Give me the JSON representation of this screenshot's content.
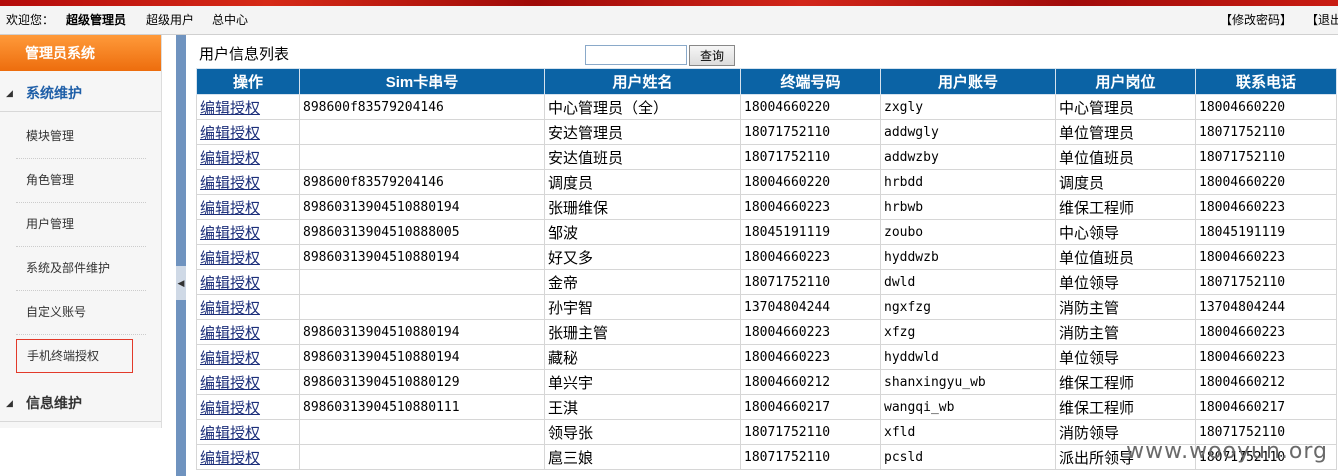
{
  "topbar": {
    "welcome": "欢迎您：",
    "user_name": "超级管理员",
    "role": "超级用户",
    "center": "总中心",
    "change_password": "【修改密码】",
    "logout": "【退出"
  },
  "sidebar": {
    "header": "管理员系统",
    "groups": [
      {
        "label": "系统维护"
      },
      {
        "label": "信息维护"
      }
    ],
    "items": [
      {
        "label": "模块管理"
      },
      {
        "label": "角色管理"
      },
      {
        "label": "用户管理"
      },
      {
        "label": "系统及部件维护"
      },
      {
        "label": "自定义账号"
      },
      {
        "label": "手机终端授权"
      }
    ],
    "active_item": "手机终端授权"
  },
  "main": {
    "title": "用户信息列表",
    "search": {
      "value": "",
      "placeholder": ""
    },
    "query_button": "查询",
    "columns": [
      "操作",
      "Sim卡串号",
      "用户姓名",
      "终端号码",
      "用户账号",
      "用户岗位",
      "联系电话"
    ],
    "rows": [
      [
        "编辑授权",
        "898600f83579204146",
        "中心管理员（全）",
        "18004660220",
        "zxgly",
        "中心管理员",
        "18004660220"
      ],
      [
        "编辑授权",
        "",
        "安达管理员",
        "18071752110",
        "addwgly",
        "单位管理员",
        "18071752110"
      ],
      [
        "编辑授权",
        "",
        "安达值班员",
        "18071752110",
        "addwzby",
        "单位值班员",
        "18071752110"
      ],
      [
        "编辑授权",
        "898600f83579204146",
        "调度员",
        "18004660220",
        "hrbdd",
        "调度员",
        "18004660220"
      ],
      [
        "编辑授权",
        "89860313904510880194",
        "张珊维保",
        "18004660223",
        "hrbwb",
        "维保工程师",
        "18004660223"
      ],
      [
        "编辑授权",
        "89860313904510888005",
        "邹波",
        "18045191119",
        "zoubo",
        "中心领导",
        "18045191119"
      ],
      [
        "编辑授权",
        "89860313904510880194",
        "好又多",
        "18004660223",
        "hyddwzb",
        "单位值班员",
        "18004660223"
      ],
      [
        "编辑授权",
        "",
        "金帝",
        "18071752110",
        "dwld",
        "单位领导",
        "18071752110"
      ],
      [
        "编辑授权",
        "",
        "孙宇智",
        "13704804244",
        "ngxfzg",
        "消防主管",
        "13704804244"
      ],
      [
        "编辑授权",
        "89860313904510880194",
        "张珊主管",
        "18004660223",
        "xfzg",
        "消防主管",
        "18004660223"
      ],
      [
        "编辑授权",
        "89860313904510880194",
        "藏秘",
        "18004660223",
        "hyddwld",
        "单位领导",
        "18004660223"
      ],
      [
        "编辑授权",
        "89860313904510880129",
        "单兴宇",
        "18004660212",
        "shanxingyu_wb",
        "维保工程师",
        "18004660212"
      ],
      [
        "编辑授权",
        "89860313904510880111",
        "王淇",
        "18004660217",
        "wangqi_wb",
        "维保工程师",
        "18004660217"
      ],
      [
        "编辑授权",
        "",
        "领导张",
        "18071752110",
        "xfld",
        "消防领导",
        "18071752110"
      ],
      [
        "编辑授权",
        "",
        "扈三娘",
        "18071752110",
        "pcsld",
        "派出所领导",
        "18071752110"
      ]
    ]
  },
  "watermark": "www.wooyun.org",
  "colors": {
    "header_blue": "#0b63a5",
    "sidebar_orange": "#ed6d0d",
    "link": "#1c2f7a",
    "active_border": "#e23a2a"
  }
}
